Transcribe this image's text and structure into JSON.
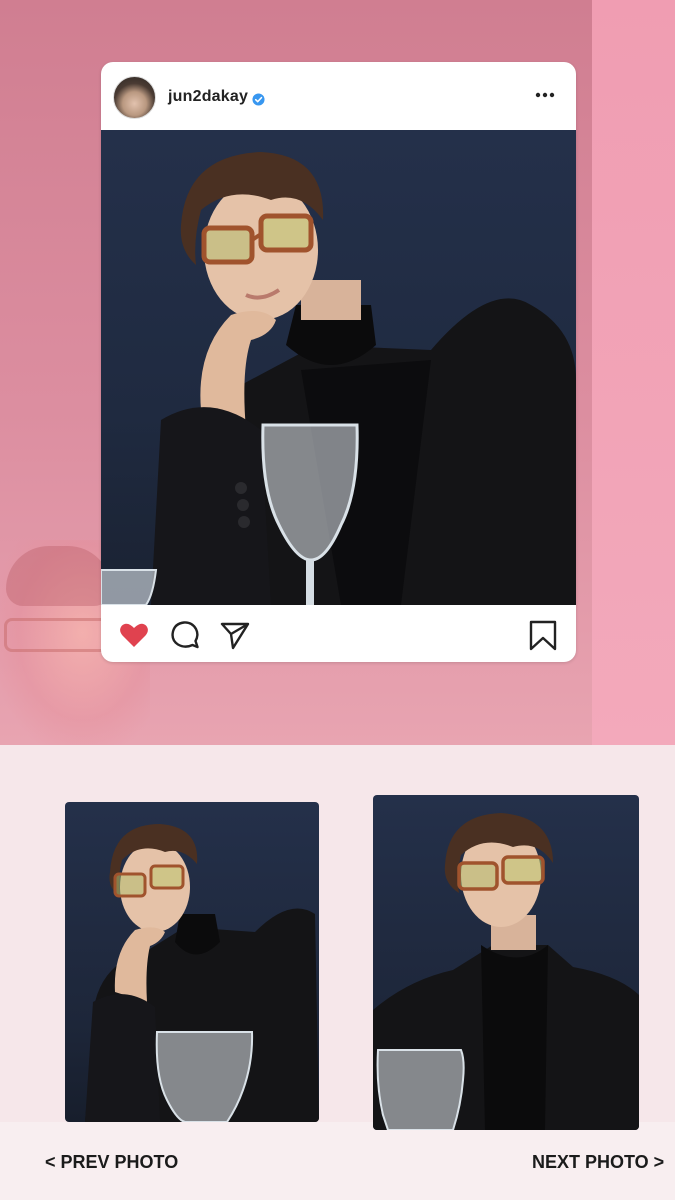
{
  "post": {
    "username": "jun2dakay",
    "verified": true,
    "icons": {
      "avatar": "profile-avatar",
      "verified": "verified-badge-icon",
      "more": "more-options-icon",
      "like": "heart-icon",
      "comment": "comment-icon",
      "share": "send-icon",
      "save": "bookmark-icon"
    },
    "liked": true
  },
  "navigation": {
    "prev_label": "< PREV PHOTO",
    "next_label": "NEXT PHOTO >"
  },
  "colors": {
    "background_top": "#d07e91",
    "accent_strip": "#f09db2",
    "background_bottom": "#f6e7ea",
    "heart": "#e0424f",
    "verified": "#3897f0",
    "photo_backdrop": "#1f2a40"
  }
}
